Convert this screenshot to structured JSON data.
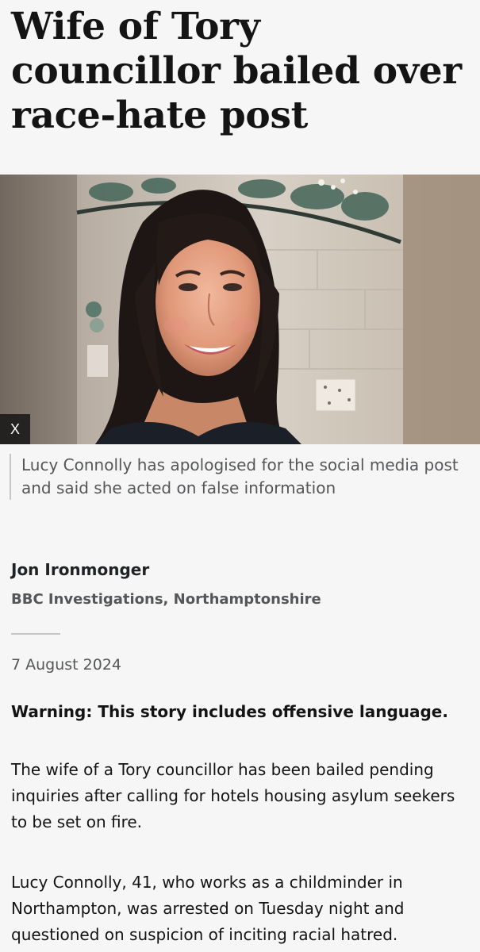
{
  "article": {
    "headline": "Wife of Tory councillor bailed over race-hate post",
    "image": {
      "close_label": "X",
      "caption": "Lucy Connolly has apologised for the social media post and said she acted on false information"
    },
    "author": {
      "name": "Jon Ironmonger",
      "role": "BBC Investigations, Northamptonshire"
    },
    "date": "7 August 2024",
    "warning": "Warning: This story includes offensive language.",
    "paragraphs": [
      "The wife of a Tory councillor has been bailed pending inquiries after calling for hotels housing asylum seekers to be set on fire.",
      "Lucy Connolly, 41, who works as a childminder in Northampton, was arrested on Tuesday night and questioned on suspicion of inciting racial hatred."
    ]
  },
  "colors": {
    "background": "#f6f6f6",
    "text": "#141414",
    "muted_text": "#545658",
    "rule": "#c4c4c4"
  }
}
